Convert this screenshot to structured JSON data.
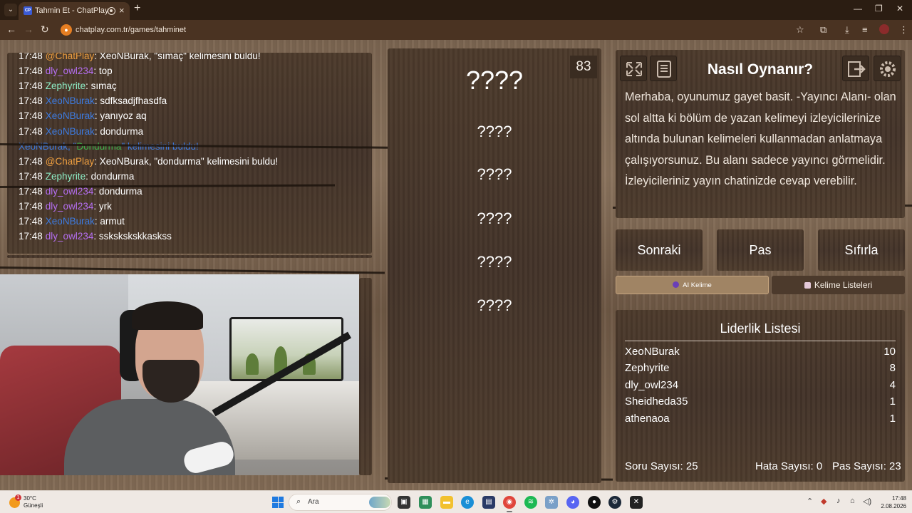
{
  "browser": {
    "tab_title": "Tahmin Et - ChatPlay",
    "tab_favicon": "CP",
    "url": "chatplay.com.tr/games/tahminet"
  },
  "chat": {
    "lines": [
      {
        "time": "17:48",
        "user": "@ChatPlay",
        "user_color": "chatplay",
        "text": ": XeoNBurak, \"sımaç\" kelimesini buldu!"
      },
      {
        "time": "17:48",
        "user": "dly_owl234",
        "user_color": "dly",
        "text": ": top"
      },
      {
        "time": "17:48",
        "user": "Zephyrite",
        "user_color": "zeph",
        "text": ": sımaç"
      },
      {
        "time": "17:48",
        "user": "XeoNBurak",
        "user_color": "xeo",
        "text": ": sdfksadjfhasdfa"
      },
      {
        "time": "17:48",
        "user": "XeoNBurak",
        "user_color": "xeo",
        "text": ": yanıyoz aq"
      },
      {
        "time": "17:48",
        "user": "XeoNBurak",
        "user_color": "xeo",
        "text": ": dondurma"
      },
      {
        "time": "",
        "user": "XeoNBurak, \"",
        "user_color": "xeo",
        "word": "Dondurma",
        "tail": "\" kelimesini buldu!",
        "system": true
      },
      {
        "time": "17:48",
        "user": "@ChatPlay",
        "user_color": "chatplay",
        "text": ": XeoNBurak, \"dondurma\" kelimesini buldu!"
      },
      {
        "time": "17:48",
        "user": "Zephyrite",
        "user_color": "zeph",
        "text": ": dondurma"
      },
      {
        "time": "17:48",
        "user": "dly_owl234",
        "user_color": "dly",
        "text": ": dondurma"
      },
      {
        "time": "17:48",
        "user": "dly_owl234",
        "user_color": "dly",
        "text": ": yrk"
      },
      {
        "time": "17:48",
        "user": "XeoNBurak",
        "user_color": "xeo",
        "text": ": armut"
      },
      {
        "time": "17:48",
        "user": "dly_owl234",
        "user_color": "dly",
        "text": ": sskskskskkaskss"
      }
    ]
  },
  "game": {
    "timer": "83",
    "main_word": "????",
    "words": [
      "????",
      "????",
      "????",
      "????",
      "????"
    ]
  },
  "rules": {
    "title": "Nasıl Oynanır?",
    "text": "Merhaba, oyunumuz gayet basit. -Yayıncı Alanı- olan sol altta ki bölüm de yazan kelimeyi izleyicilerinize altında bulunan kelimeleri kullanmadan anlatmaya çalışıyorsunuz. Bu alanı sadece yayıncı görmelidir. İzleyicileriniz yayın chatinizde cevap verebilir.",
    "icons": [
      "fullscreen-icon",
      "notes-icon",
      "exit-icon",
      "gear-icon"
    ]
  },
  "controls": {
    "next_label": "Sonraki",
    "pass_label": "Pas",
    "reset_label": "Sıfırla",
    "ai_word_label": "AI Kelime",
    "word_lists_label": "Kelime Listeleri"
  },
  "leaderboard": {
    "title": "Liderlik Listesi",
    "rows": [
      {
        "name": "XeoNBurak",
        "score": "10"
      },
      {
        "name": "Zephyrite",
        "score": "8"
      },
      {
        "name": "dly_owl234",
        "score": "4"
      },
      {
        "name": "Sheidheda35",
        "score": "1"
      },
      {
        "name": "athenaoa",
        "score": "1"
      }
    ],
    "question_count": "Soru Sayısı: 25",
    "error_count": "Hata Sayısı: 0",
    "pass_count": "Pas Sayısı: 23"
  },
  "taskbar": {
    "weather_temp": "30°C",
    "weather_desc": "Güneşli",
    "weather_badge": "1",
    "search_placeholder": "Ara",
    "time": "17:48",
    "date": "2.08.2026"
  },
  "colors": {
    "chatplay": "#f0a040",
    "dly": "#b36df0",
    "zeph": "#8ff0c8",
    "xeo": "#3d7be0",
    "found_word": "#3db34a"
  }
}
